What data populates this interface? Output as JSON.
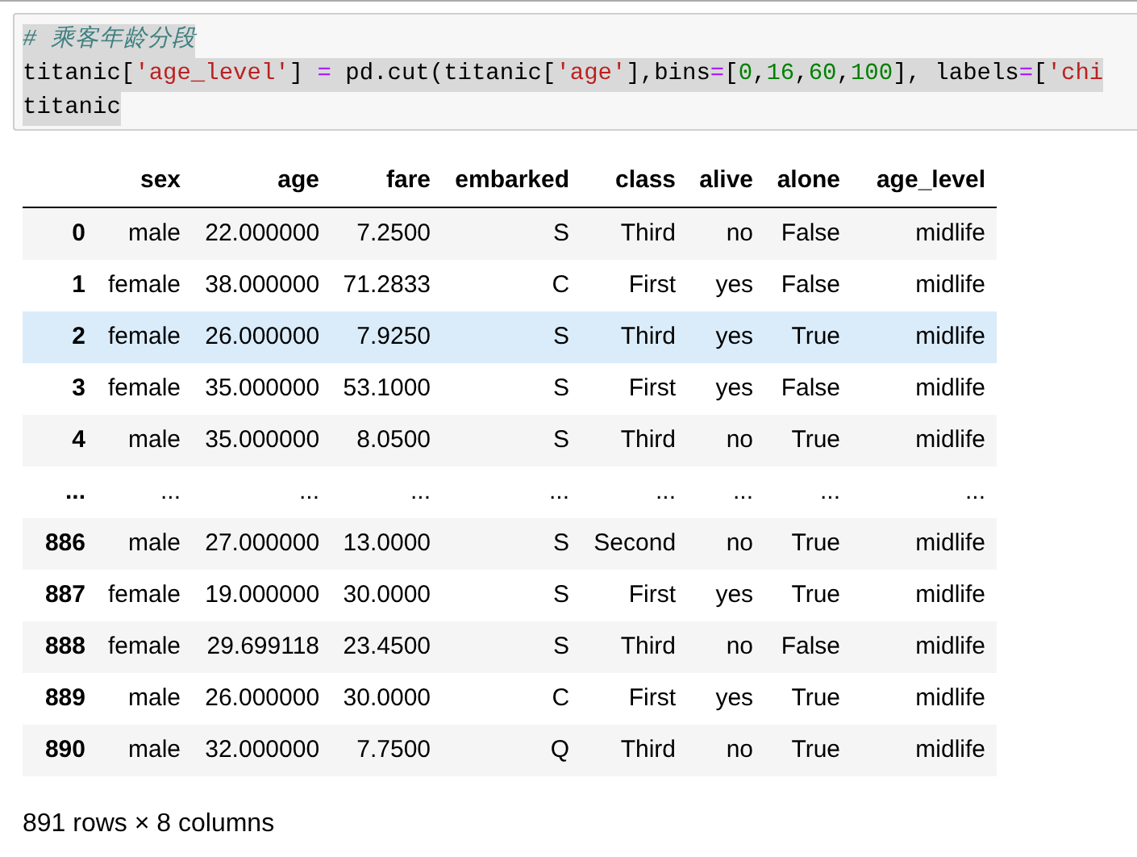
{
  "code_cell": {
    "lines": [
      [
        {
          "kind": "comment",
          "text": "# 乘客年龄分段"
        }
      ],
      [
        {
          "kind": "plain",
          "text": "titanic["
        },
        {
          "kind": "string",
          "text": "'age_level'"
        },
        {
          "kind": "plain",
          "text": "] "
        },
        {
          "kind": "operator",
          "text": "="
        },
        {
          "kind": "plain",
          "text": " pd.cut(titanic["
        },
        {
          "kind": "string",
          "text": "'age'"
        },
        {
          "kind": "plain",
          "text": "],bins"
        },
        {
          "kind": "operator",
          "text": "="
        },
        {
          "kind": "plain",
          "text": "["
        },
        {
          "kind": "number",
          "text": "0"
        },
        {
          "kind": "plain",
          "text": ","
        },
        {
          "kind": "number",
          "text": "16"
        },
        {
          "kind": "plain",
          "text": ","
        },
        {
          "kind": "number",
          "text": "60"
        },
        {
          "kind": "plain",
          "text": ","
        },
        {
          "kind": "number",
          "text": "100"
        },
        {
          "kind": "plain",
          "text": "], labels"
        },
        {
          "kind": "operator",
          "text": "="
        },
        {
          "kind": "plain",
          "text": "["
        },
        {
          "kind": "string",
          "text": "'chi"
        }
      ],
      [
        {
          "kind": "plain",
          "text": "titanic"
        }
      ]
    ]
  },
  "table": {
    "columns": [
      "",
      "sex",
      "age",
      "fare",
      "embarked",
      "class",
      "alive",
      "alone",
      "age_level"
    ],
    "rows": [
      {
        "selected": false,
        "cells": [
          "0",
          "male",
          "22.000000",
          "7.2500",
          "S",
          "Third",
          "no",
          "False",
          "midlife"
        ]
      },
      {
        "selected": false,
        "cells": [
          "1",
          "female",
          "38.000000",
          "71.2833",
          "C",
          "First",
          "yes",
          "False",
          "midlife"
        ]
      },
      {
        "selected": true,
        "cells": [
          "2",
          "female",
          "26.000000",
          "7.9250",
          "S",
          "Third",
          "yes",
          "True",
          "midlife"
        ]
      },
      {
        "selected": false,
        "cells": [
          "3",
          "female",
          "35.000000",
          "53.1000",
          "S",
          "First",
          "yes",
          "False",
          "midlife"
        ]
      },
      {
        "selected": false,
        "cells": [
          "4",
          "male",
          "35.000000",
          "8.0500",
          "S",
          "Third",
          "no",
          "True",
          "midlife"
        ]
      },
      {
        "selected": false,
        "cells": [
          "...",
          "...",
          "...",
          "...",
          "...",
          "...",
          "...",
          "...",
          "..."
        ]
      },
      {
        "selected": false,
        "cells": [
          "886",
          "male",
          "27.000000",
          "13.0000",
          "S",
          "Second",
          "no",
          "True",
          "midlife"
        ]
      },
      {
        "selected": false,
        "cells": [
          "887",
          "female",
          "19.000000",
          "30.0000",
          "S",
          "First",
          "yes",
          "True",
          "midlife"
        ]
      },
      {
        "selected": false,
        "cells": [
          "888",
          "female",
          "29.699118",
          "23.4500",
          "S",
          "Third",
          "no",
          "False",
          "midlife"
        ]
      },
      {
        "selected": false,
        "cells": [
          "889",
          "male",
          "26.000000",
          "30.0000",
          "C",
          "First",
          "yes",
          "True",
          "midlife"
        ]
      },
      {
        "selected": false,
        "cells": [
          "890",
          "male",
          "32.000000",
          "7.7500",
          "Q",
          "Third",
          "no",
          "True",
          "midlife"
        ]
      }
    ]
  },
  "summary": "891 rows × 8 columns"
}
